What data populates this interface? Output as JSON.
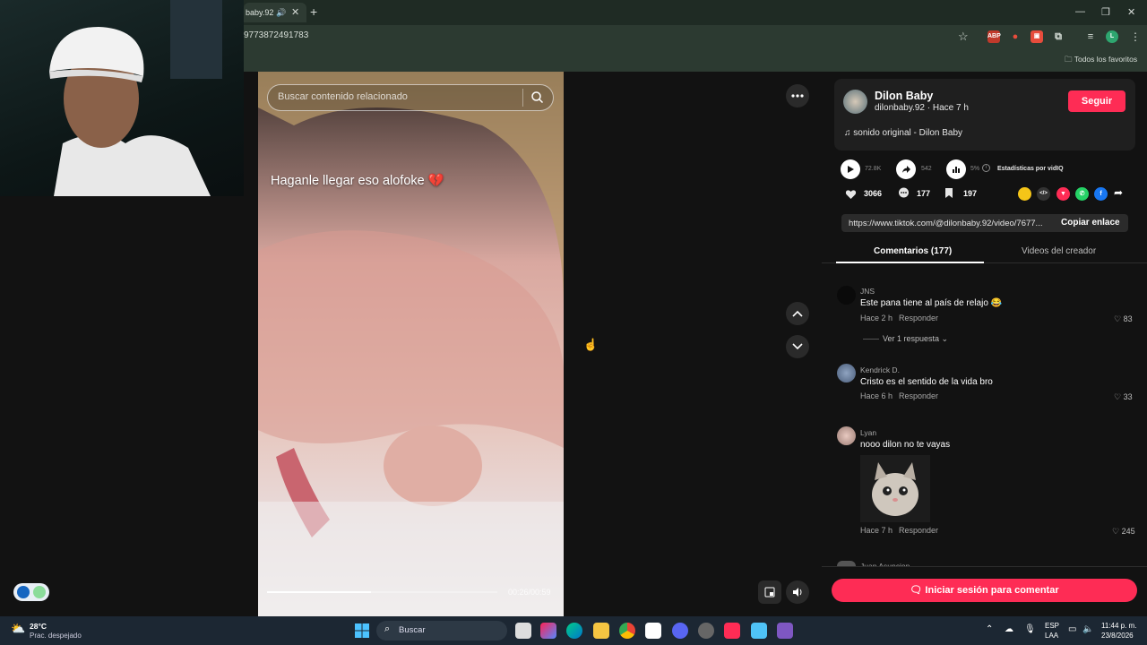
{
  "browser": {
    "tab_title": "baby.92",
    "tab_speaker": "🔊",
    "tab_close": "✕",
    "new_tab": "+",
    "url": "9773872491783",
    "bookmarks_label": "Todos los favoritos",
    "extensions": [
      "ABP",
      "●",
      "▣",
      "⧉",
      "≡",
      "L"
    ],
    "window_controls": [
      "—",
      "❐",
      "✕"
    ],
    "menu": "⋮"
  },
  "video": {
    "search_placeholder": "Buscar contenido relacionado",
    "caption": "Haganle llegar eso alofoke 💔",
    "timecode": "00:26/00:59",
    "progress": 0.45
  },
  "author": {
    "name": "Dilon Baby",
    "handle": "dilonbaby.92 · Hace 7 h",
    "follow_label": "Seguir",
    "music": "sonido original - Dilon Baby"
  },
  "stats": {
    "plays": "72.8K",
    "shares": "542",
    "engagement": "5%",
    "vidiq_label": "Estadísticas por vidIQ",
    "likes": "3066",
    "comments": "177",
    "saves": "197"
  },
  "link": {
    "url": "https://www.tiktok.com/@dilonbaby.92/video/7677...",
    "copy_label": "Copiar enlace"
  },
  "tabs": {
    "comments": "Comentarios (177)",
    "creator_videos": "Videos del creador"
  },
  "comments": [
    {
      "name": "JNS",
      "text": "Este pana tiene al país de relajo 😂",
      "time": "Hace 2 h",
      "reply": "Responder",
      "likes": "83",
      "replies": "Ver 1 respuesta"
    },
    {
      "name": "Kendrick D.",
      "text": "Cristo es el sentido de la vida bro",
      "time": "Hace 6 h",
      "reply": "Responder",
      "likes": "33"
    },
    {
      "name": "Lyan",
      "text": "nooo dilon no te vayas",
      "time": "Hace 7 h",
      "reply": "Responder",
      "likes": "245"
    },
    {
      "name": "Juan Asuncion"
    }
  ],
  "login_label": "Iniciar sesión para comentar",
  "taskbar": {
    "weather_temp": "28°C",
    "weather_desc": "Prac. despejado",
    "search": "Buscar",
    "lang_top": "ESP",
    "lang_bottom": "LAA",
    "time": "11:44 p. m.",
    "date": "23/8/2026"
  },
  "colors": {
    "accent": "#fe2c55",
    "panel": "#1f1f1f",
    "background": "#121212"
  }
}
